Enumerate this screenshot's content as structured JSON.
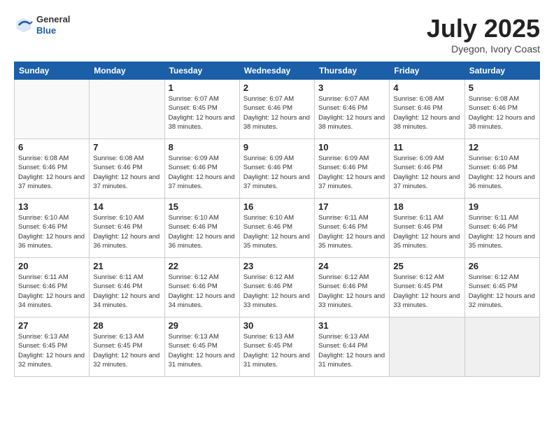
{
  "header": {
    "logo": {
      "general": "General",
      "blue": "Blue"
    },
    "title": "July 2025",
    "location": "Dyegon, Ivory Coast"
  },
  "weekdays": [
    "Sunday",
    "Monday",
    "Tuesday",
    "Wednesday",
    "Thursday",
    "Friday",
    "Saturday"
  ],
  "weeks": [
    [
      {
        "day": "",
        "sunrise": "",
        "sunset": "",
        "daylight": ""
      },
      {
        "day": "",
        "sunrise": "",
        "sunset": "",
        "daylight": ""
      },
      {
        "day": "1",
        "sunrise": "Sunrise: 6:07 AM",
        "sunset": "Sunset: 6:45 PM",
        "daylight": "Daylight: 12 hours and 38 minutes."
      },
      {
        "day": "2",
        "sunrise": "Sunrise: 6:07 AM",
        "sunset": "Sunset: 6:46 PM",
        "daylight": "Daylight: 12 hours and 38 minutes."
      },
      {
        "day": "3",
        "sunrise": "Sunrise: 6:07 AM",
        "sunset": "Sunset: 6:46 PM",
        "daylight": "Daylight: 12 hours and 38 minutes."
      },
      {
        "day": "4",
        "sunrise": "Sunrise: 6:08 AM",
        "sunset": "Sunset: 6:46 PM",
        "daylight": "Daylight: 12 hours and 38 minutes."
      },
      {
        "day": "5",
        "sunrise": "Sunrise: 6:08 AM",
        "sunset": "Sunset: 6:46 PM",
        "daylight": "Daylight: 12 hours and 38 minutes."
      }
    ],
    [
      {
        "day": "6",
        "sunrise": "Sunrise: 6:08 AM",
        "sunset": "Sunset: 6:46 PM",
        "daylight": "Daylight: 12 hours and 37 minutes."
      },
      {
        "day": "7",
        "sunrise": "Sunrise: 6:08 AM",
        "sunset": "Sunset: 6:46 PM",
        "daylight": "Daylight: 12 hours and 37 minutes."
      },
      {
        "day": "8",
        "sunrise": "Sunrise: 6:09 AM",
        "sunset": "Sunset: 6:46 PM",
        "daylight": "Daylight: 12 hours and 37 minutes."
      },
      {
        "day": "9",
        "sunrise": "Sunrise: 6:09 AM",
        "sunset": "Sunset: 6:46 PM",
        "daylight": "Daylight: 12 hours and 37 minutes."
      },
      {
        "day": "10",
        "sunrise": "Sunrise: 6:09 AM",
        "sunset": "Sunset: 6:46 PM",
        "daylight": "Daylight: 12 hours and 37 minutes."
      },
      {
        "day": "11",
        "sunrise": "Sunrise: 6:09 AM",
        "sunset": "Sunset: 6:46 PM",
        "daylight": "Daylight: 12 hours and 37 minutes."
      },
      {
        "day": "12",
        "sunrise": "Sunrise: 6:10 AM",
        "sunset": "Sunset: 6:46 PM",
        "daylight": "Daylight: 12 hours and 36 minutes."
      }
    ],
    [
      {
        "day": "13",
        "sunrise": "Sunrise: 6:10 AM",
        "sunset": "Sunset: 6:46 PM",
        "daylight": "Daylight: 12 hours and 36 minutes."
      },
      {
        "day": "14",
        "sunrise": "Sunrise: 6:10 AM",
        "sunset": "Sunset: 6:46 PM",
        "daylight": "Daylight: 12 hours and 36 minutes."
      },
      {
        "day": "15",
        "sunrise": "Sunrise: 6:10 AM",
        "sunset": "Sunset: 6:46 PM",
        "daylight": "Daylight: 12 hours and 36 minutes."
      },
      {
        "day": "16",
        "sunrise": "Sunrise: 6:10 AM",
        "sunset": "Sunset: 6:46 PM",
        "daylight": "Daylight: 12 hours and 35 minutes."
      },
      {
        "day": "17",
        "sunrise": "Sunrise: 6:11 AM",
        "sunset": "Sunset: 6:46 PM",
        "daylight": "Daylight: 12 hours and 35 minutes."
      },
      {
        "day": "18",
        "sunrise": "Sunrise: 6:11 AM",
        "sunset": "Sunset: 6:46 PM",
        "daylight": "Daylight: 12 hours and 35 minutes."
      },
      {
        "day": "19",
        "sunrise": "Sunrise: 6:11 AM",
        "sunset": "Sunset: 6:46 PM",
        "daylight": "Daylight: 12 hours and 35 minutes."
      }
    ],
    [
      {
        "day": "20",
        "sunrise": "Sunrise: 6:11 AM",
        "sunset": "Sunset: 6:46 PM",
        "daylight": "Daylight: 12 hours and 34 minutes."
      },
      {
        "day": "21",
        "sunrise": "Sunrise: 6:11 AM",
        "sunset": "Sunset: 6:46 PM",
        "daylight": "Daylight: 12 hours and 34 minutes."
      },
      {
        "day": "22",
        "sunrise": "Sunrise: 6:12 AM",
        "sunset": "Sunset: 6:46 PM",
        "daylight": "Daylight: 12 hours and 34 minutes."
      },
      {
        "day": "23",
        "sunrise": "Sunrise: 6:12 AM",
        "sunset": "Sunset: 6:46 PM",
        "daylight": "Daylight: 12 hours and 33 minutes."
      },
      {
        "day": "24",
        "sunrise": "Sunrise: 6:12 AM",
        "sunset": "Sunset: 6:46 PM",
        "daylight": "Daylight: 12 hours and 33 minutes."
      },
      {
        "day": "25",
        "sunrise": "Sunrise: 6:12 AM",
        "sunset": "Sunset: 6:45 PM",
        "daylight": "Daylight: 12 hours and 33 minutes."
      },
      {
        "day": "26",
        "sunrise": "Sunrise: 6:12 AM",
        "sunset": "Sunset: 6:45 PM",
        "daylight": "Daylight: 12 hours and 32 minutes."
      }
    ],
    [
      {
        "day": "27",
        "sunrise": "Sunrise: 6:13 AM",
        "sunset": "Sunset: 6:45 PM",
        "daylight": "Daylight: 12 hours and 32 minutes."
      },
      {
        "day": "28",
        "sunrise": "Sunrise: 6:13 AM",
        "sunset": "Sunset: 6:45 PM",
        "daylight": "Daylight: 12 hours and 32 minutes."
      },
      {
        "day": "29",
        "sunrise": "Sunrise: 6:13 AM",
        "sunset": "Sunset: 6:45 PM",
        "daylight": "Daylight: 12 hours and 31 minutes."
      },
      {
        "day": "30",
        "sunrise": "Sunrise: 6:13 AM",
        "sunset": "Sunset: 6:45 PM",
        "daylight": "Daylight: 12 hours and 31 minutes."
      },
      {
        "day": "31",
        "sunrise": "Sunrise: 6:13 AM",
        "sunset": "Sunset: 6:44 PM",
        "daylight": "Daylight: 12 hours and 31 minutes."
      },
      {
        "day": "",
        "sunrise": "",
        "sunset": "",
        "daylight": ""
      },
      {
        "day": "",
        "sunrise": "",
        "sunset": "",
        "daylight": ""
      }
    ]
  ]
}
